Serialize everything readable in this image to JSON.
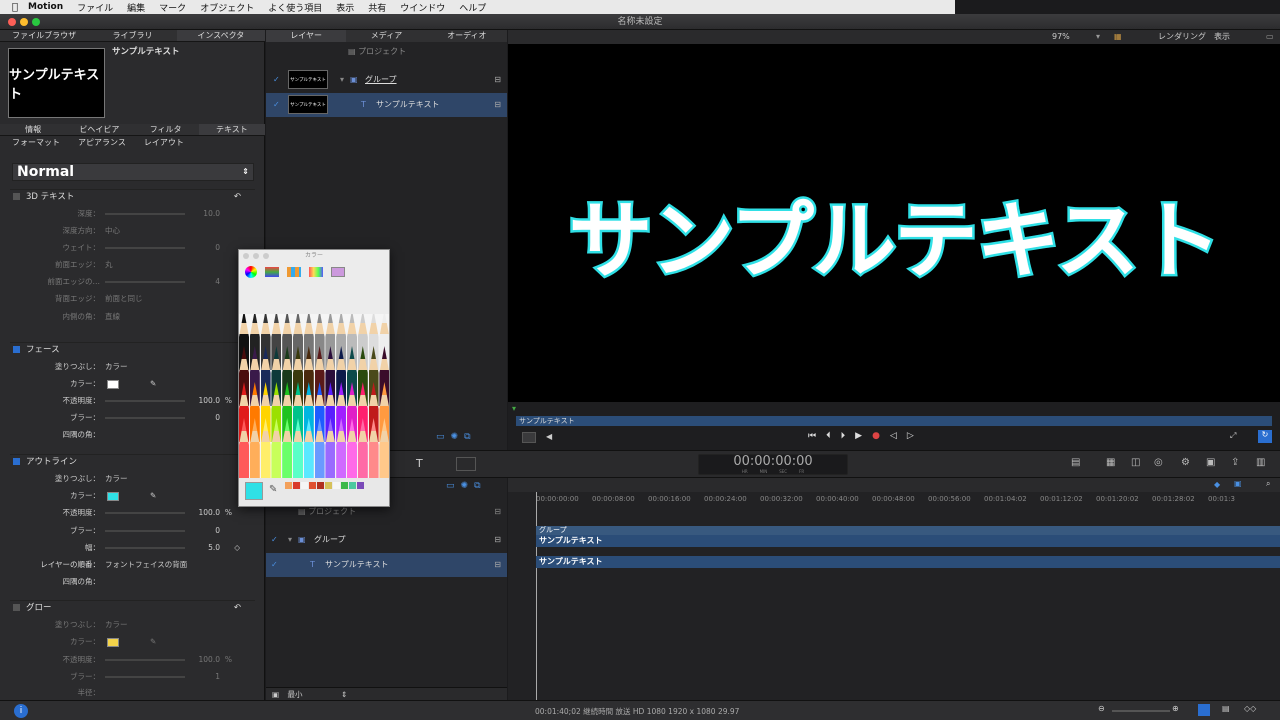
{
  "menubar": {
    "app": "Motion",
    "items": [
      "ファイル",
      "編集",
      "マーク",
      "オブジェクト",
      "よく使う項目",
      "表示",
      "共有",
      "ウインドウ",
      "ヘルプ"
    ]
  },
  "window": {
    "title": "名称未設定"
  },
  "inspector": {
    "top_tabs": [
      "ファイルブラウザ",
      "ライブラリ",
      "インスペクタ"
    ],
    "object_name": "サンプルテキスト",
    "thumb_text": "サンプルテキスト",
    "tabs": [
      "情報",
      "ビヘイビア",
      "フィルタ",
      "テキスト"
    ],
    "subtabs": [
      "フォーマット",
      "アピアランス",
      "レイアウト"
    ],
    "preset": "Normal",
    "text3d": {
      "title": "3D テキスト",
      "depth_label": "深度：",
      "depth_value": "10.0",
      "direction_label": "深度方向：",
      "direction_value": "中心",
      "weight_label": "ウェイト：",
      "weight_value": "0",
      "front_edge_label": "前面エッジ：",
      "front_edge_value": "丸",
      "front_edge2_label": "前面エッジの…",
      "front_edge2_value": "4",
      "back_edge_label": "背面エッジ：",
      "back_edge_value": "前面と同じ",
      "inner_corner_label": "内側の角：",
      "inner_corner_value": "直線"
    },
    "face": {
      "title": "フェース",
      "fill_label": "塗りつぶし：",
      "fill_value": "カラー",
      "color_label": "カラー：",
      "color": "#ffffff",
      "opacity_label": "不透明度：",
      "opacity_value": "100.0",
      "opacity_unit": "%",
      "blur_label": "ブラー：",
      "blur_value": "0",
      "corner_label": "四隅の角："
    },
    "outline": {
      "title": "アウトライン",
      "fill_label": "塗りつぶし：",
      "fill_value": "カラー",
      "color_label": "カラー：",
      "color": "#2fe0e6",
      "opacity_label": "不透明度：",
      "opacity_value": "100.0",
      "opacity_unit": "%",
      "blur_label": "ブラー：",
      "blur_value": "0",
      "width_label": "幅：",
      "width_value": "5.0",
      "order_label": "レイヤーの順番：",
      "order_value": "フォントフェイスの背面",
      "corner_label": "四隅の角："
    },
    "glow": {
      "title": "グロー",
      "fill_label": "塗りつぶし：",
      "fill_value": "カラー",
      "color_label": "カラー：",
      "color": "#f3d34a",
      "opacity_label": "不透明度：",
      "opacity_value": "100.0",
      "opacity_unit": "%",
      "blur_label": "ブラー：",
      "blur_value": "1",
      "radius_label": "半径："
    }
  },
  "colors_popup": {
    "title": "カラー",
    "selected_color": "#2fe0e6"
  },
  "layers_panel": {
    "tabs": [
      "レイヤー",
      "メディア",
      "オーディオ"
    ],
    "project": "プロジェクト",
    "group": "グループ",
    "text_layer": "サンプルテキスト",
    "thumb_text": "サンプルテキスト",
    "size_label": "最小"
  },
  "viewer": {
    "zoom": "97%",
    "render": "レンダリング",
    "view": "表示",
    "text": "サンプルテキスト",
    "mini_track": "サンプルテキスト"
  },
  "timecode": "00:00:00:00",
  "timecode_units": [
    "HR",
    "MIN",
    "SEC",
    "FR"
  ],
  "timeline": {
    "ticks": [
      "00:00:00:00",
      "00:00:08:00",
      "00:00:16:00",
      "00:00:24:00",
      "00:00:32:00",
      "00:00:40:00",
      "00:00:48:00",
      "00:00:56:00",
      "00:01:04:02",
      "00:01:12:02",
      "00:01:20:02",
      "00:01:28:02",
      "00:01:3"
    ],
    "group_bar": "グループ",
    "group_text_bar": "サンプルテキスト",
    "text_bar": "サンプルテキスト"
  },
  "status": "00:01:40;02 継続時間 放送 HD 1080 1920 x 1080 29.97"
}
